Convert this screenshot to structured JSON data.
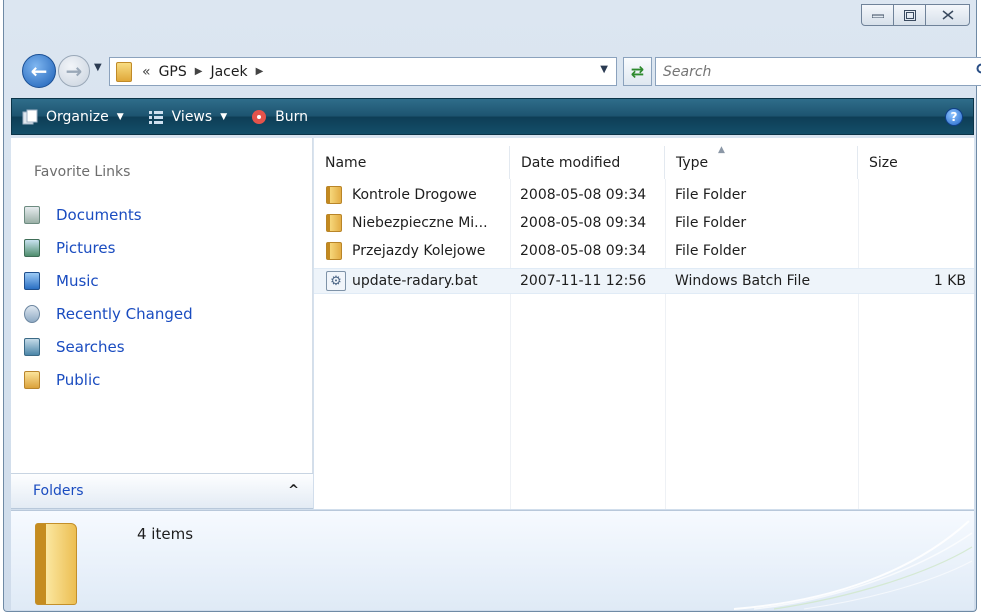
{
  "address": {
    "overflow_chevron": "«",
    "breadcrumbs": [
      "GPS",
      "Jacek"
    ],
    "search_placeholder": "Search"
  },
  "toolbar": {
    "organize": "Organize",
    "views": "Views",
    "burn": "Burn",
    "help": "?"
  },
  "nav_pane": {
    "section_title": "Favorite Links",
    "links": [
      {
        "label": "Documents",
        "icon": "documents-icon"
      },
      {
        "label": "Pictures",
        "icon": "pictures-icon"
      },
      {
        "label": "Music",
        "icon": "music-icon"
      },
      {
        "label": "Recently Changed",
        "icon": "recently-changed-icon"
      },
      {
        "label": "Searches",
        "icon": "searches-icon"
      },
      {
        "label": "Public",
        "icon": "public-folder-icon"
      }
    ],
    "folders_label": "Folders"
  },
  "columns": {
    "name": "Name",
    "date": "Date modified",
    "type": "Type",
    "size": "Size"
  },
  "files": [
    {
      "name": "Kontrole Drogowe",
      "date": "2008-05-08 09:34",
      "type": "File Folder",
      "size": "",
      "icon": "folder-icon"
    },
    {
      "name": "Niebezpieczne Mi...",
      "date": "2008-05-08 09:34",
      "type": "File Folder",
      "size": "",
      "icon": "folder-icon"
    },
    {
      "name": "Przejazdy Kolejowe",
      "date": "2008-05-08 09:34",
      "type": "File Folder",
      "size": "",
      "icon": "folder-icon"
    },
    {
      "name": "update-radary.bat",
      "date": "2007-11-11 12:56",
      "type": "Windows Batch File",
      "size": "1 KB",
      "icon": "batch-file-icon"
    }
  ],
  "details": {
    "item_count": "4 items"
  }
}
